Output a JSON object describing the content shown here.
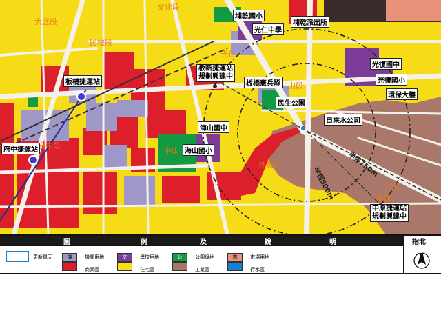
{
  "colors": {
    "residential": "#f6dc16",
    "commercial": "#dd1f2b",
    "industrial": "#a9786a",
    "institutional": "#9e98c8",
    "school": "#7d3c98",
    "park": "#159a44",
    "market": "#e8927a",
    "river": "#1a7fd0",
    "road": "#f4f1ea",
    "district_text": "#e8741a"
  },
  "districts": [
    {
      "id": "dating",
      "label": "大庭段"
    },
    {
      "id": "wenhua",
      "label": "文化段"
    },
    {
      "id": "minquan",
      "label": "民權段"
    },
    {
      "id": "fuzhong",
      "label": "府中段"
    },
    {
      "id": "zhongshan",
      "label": "中山"
    },
    {
      "id": "guangren",
      "label": "光仁"
    },
    {
      "id": "shan",
      "label": "山段"
    },
    {
      "id": "waiguan",
      "label": "外員山"
    },
    {
      "id": "zhonghe",
      "label": "中和"
    },
    {
      "id": "huaxing",
      "label": "華興"
    }
  ],
  "places": [
    {
      "id": "banqiao-elementary",
      "label": "埔乾國小"
    },
    {
      "id": "guangren-middle",
      "label": "光仁中學"
    },
    {
      "id": "police-station",
      "label": "埔乾派出所"
    },
    {
      "id": "banqiao-mrt",
      "label": "板橋捷運站"
    },
    {
      "id": "banxin-mrt",
      "label": "板新捷運站",
      "note": "規劃興建中"
    },
    {
      "id": "military-police",
      "label": "板橋憲兵隊"
    },
    {
      "id": "guangfu-junior",
      "label": "光復國中"
    },
    {
      "id": "guangfu-elementary",
      "label": "光復國小"
    },
    {
      "id": "environment-building",
      "label": "環保大樓"
    },
    {
      "id": "minsheng-park",
      "label": "民生公園"
    },
    {
      "id": "water-company",
      "label": "自來水公司"
    },
    {
      "id": "haishan-junior",
      "label": "海山國中"
    },
    {
      "id": "haishan-elementary",
      "label": "海山國小"
    },
    {
      "id": "fuzhong-mrt",
      "label": "府中捷運站"
    },
    {
      "id": "zhongyuan-mrt",
      "label": "中原捷運站",
      "note": "規劃興建中"
    }
  ],
  "radii": {
    "inner": "半徑500m",
    "outer": "半徑750m"
  },
  "legend": {
    "header": {
      "tu": "圖",
      "li": "例",
      "ji": "及",
      "shuo": "說",
      "ming": "明",
      "north": "指北"
    },
    "renewal_unit": "更新單元",
    "items": [
      {
        "key": "institutional",
        "code": "機",
        "label": "機關用地"
      },
      {
        "key": "school",
        "code": "文",
        "label": "學校用地"
      },
      {
        "key": "park",
        "code": "公",
        "label": "公園綠地"
      },
      {
        "key": "market",
        "code": "市",
        "label": "市場用地"
      },
      {
        "key": "commercial",
        "code": "",
        "label": "商業區"
      },
      {
        "key": "residential",
        "code": "",
        "label": "住宅區"
      },
      {
        "key": "industrial",
        "code": "",
        "label": "工業區"
      },
      {
        "key": "river",
        "code": "",
        "label": "行水區"
      }
    ],
    "north_letter": "N"
  }
}
